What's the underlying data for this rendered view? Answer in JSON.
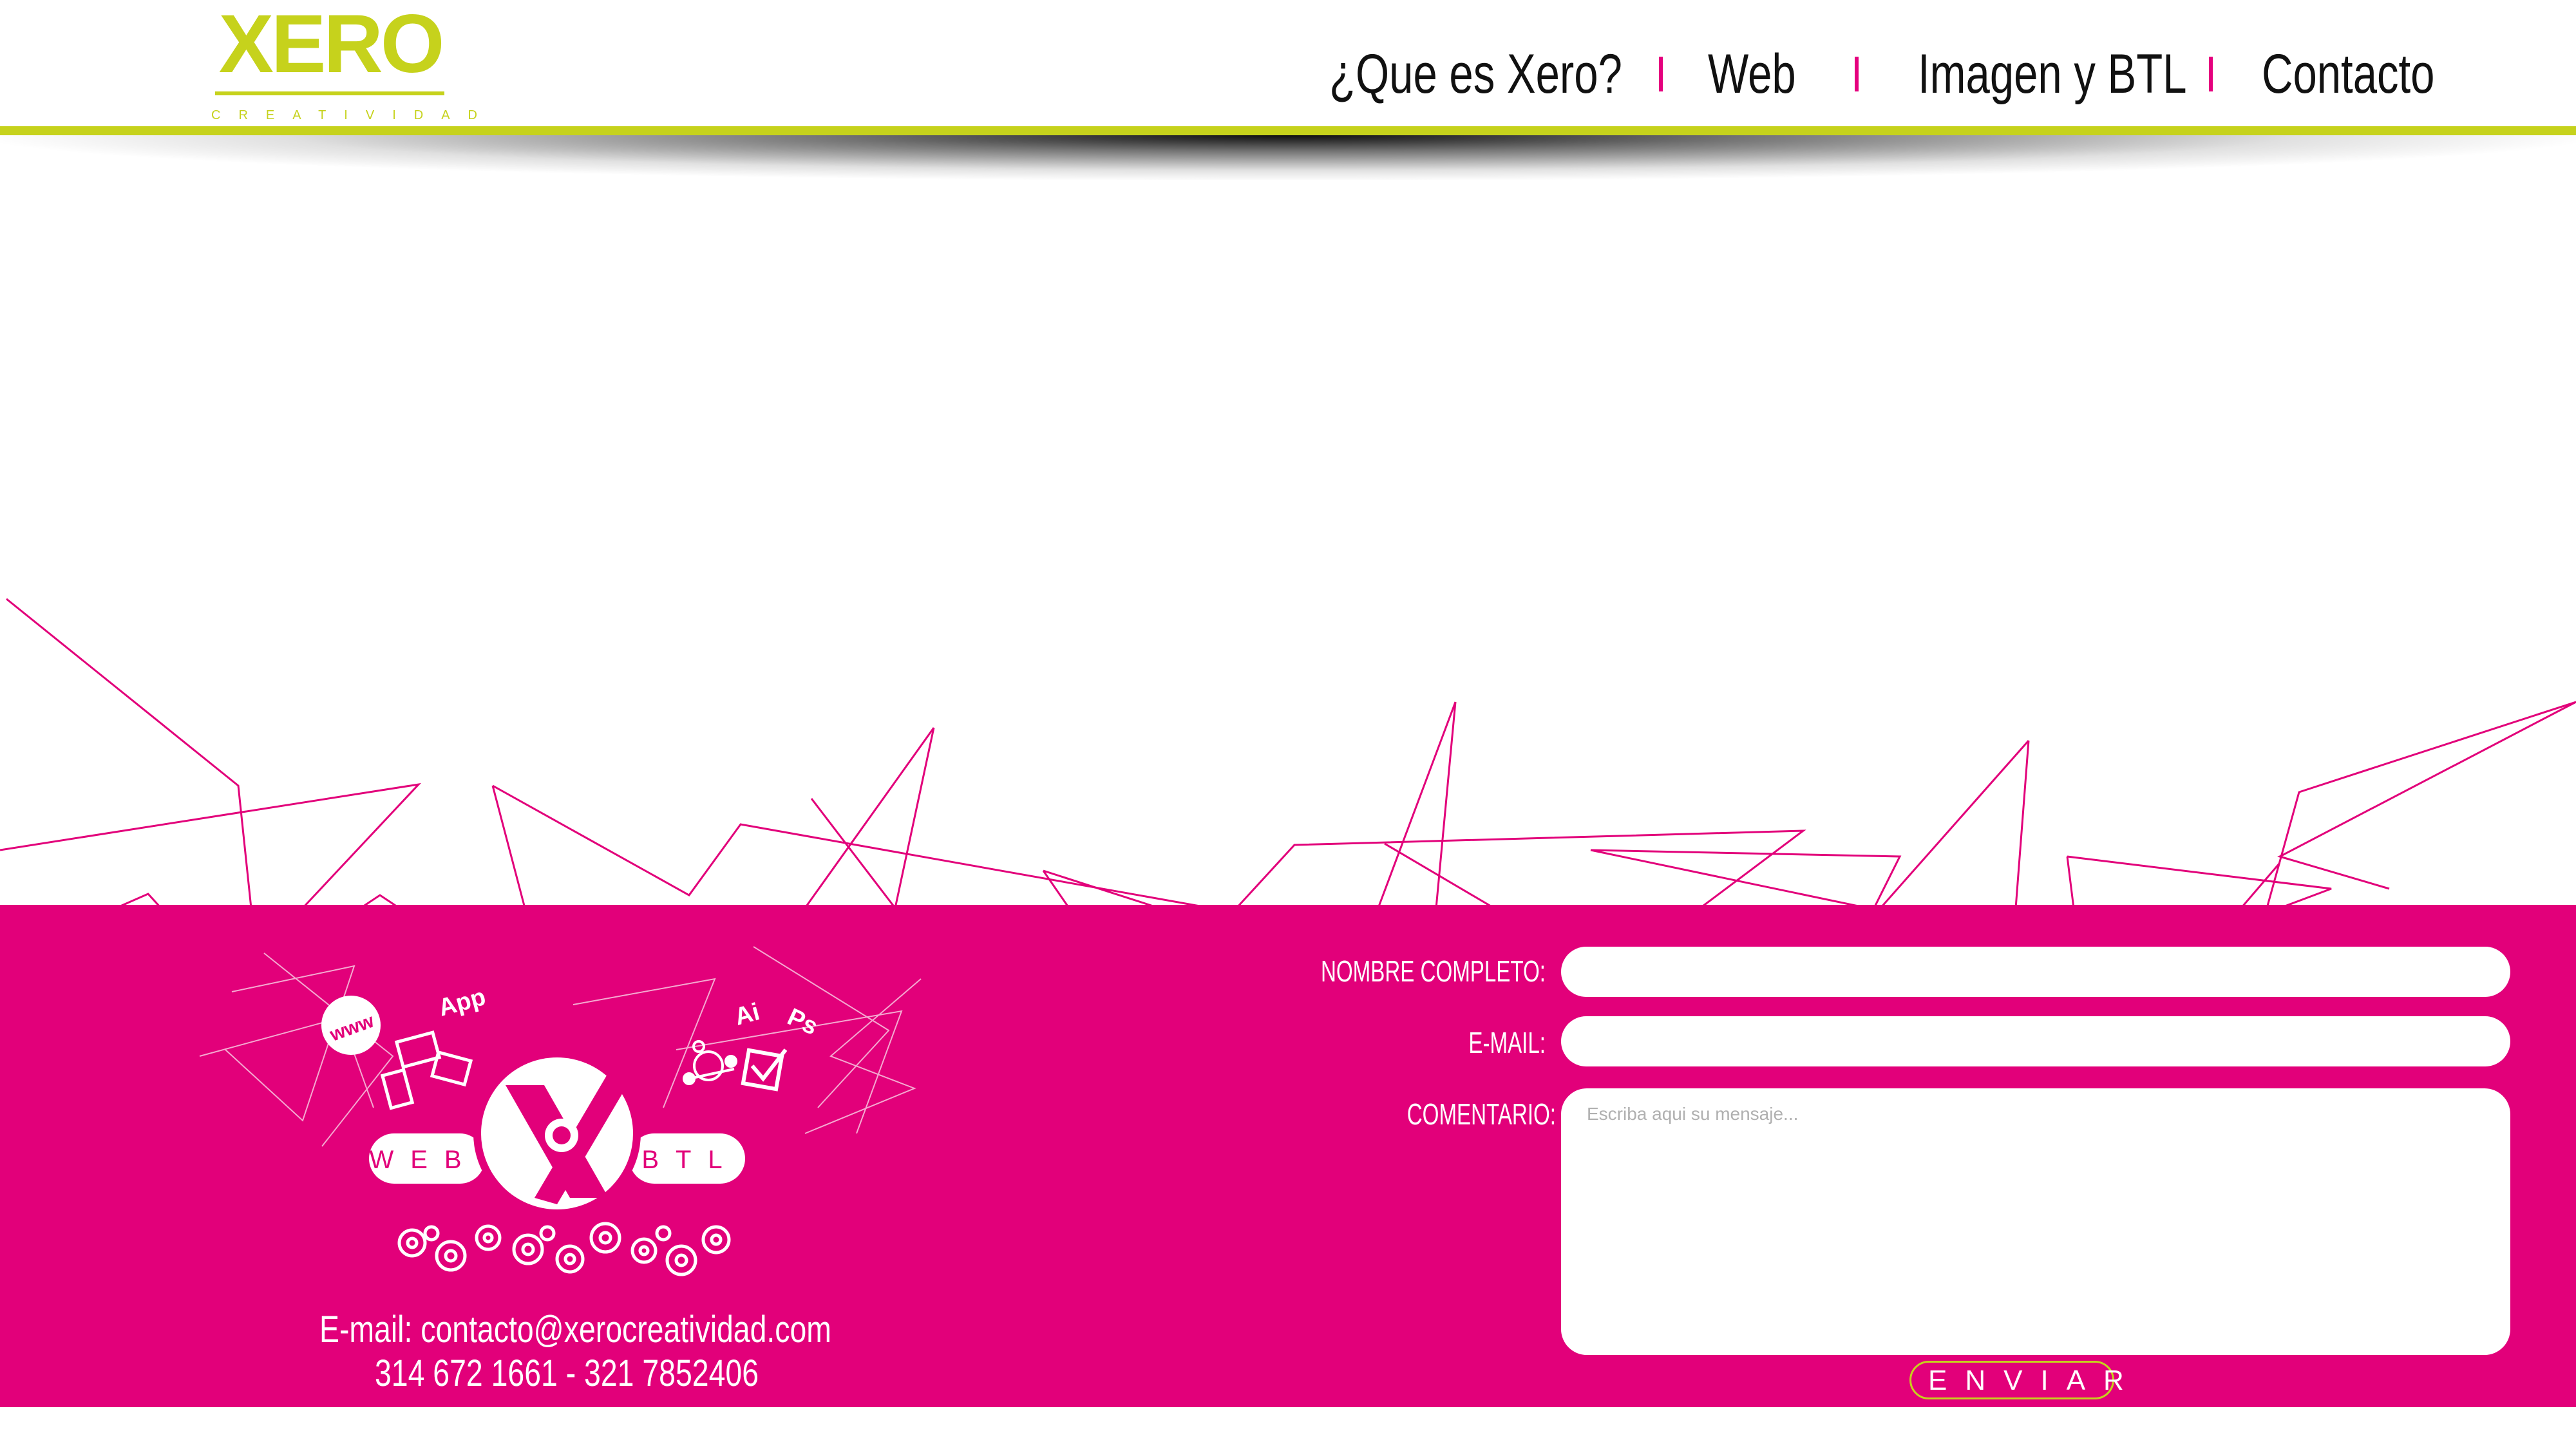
{
  "header": {
    "logo": {
      "wordmark": "XERO",
      "tagline": "CREATIVIDAD"
    },
    "nav": [
      {
        "label": "¿Que es Xero?"
      },
      {
        "label": "Web"
      },
      {
        "label": "Imagen y BTL"
      },
      {
        "label": "Contacto"
      }
    ]
  },
  "emblem": {
    "word_left": "WEB",
    "word_right": "BTL",
    "icon_labels": [
      "www",
      "App",
      "Ai",
      "Ps"
    ]
  },
  "contact": {
    "email_line": "E-mail: contacto@xerocreatividad.com",
    "phone_line": "314 672 1661 - 321 7852406"
  },
  "form": {
    "name_label": "NOMBRE COMPLETO:",
    "email_label": "E-MAIL:",
    "comment_label": "COMENTARIO:",
    "name_value": "",
    "email_value": "",
    "comment_placeholder": "Escriba aqui su mensaje...",
    "send_label": "ENVIAR"
  },
  "colors": {
    "brand_green": "#c6d21c",
    "brand_magenta": "#e2007a",
    "nav_text": "#111111"
  }
}
